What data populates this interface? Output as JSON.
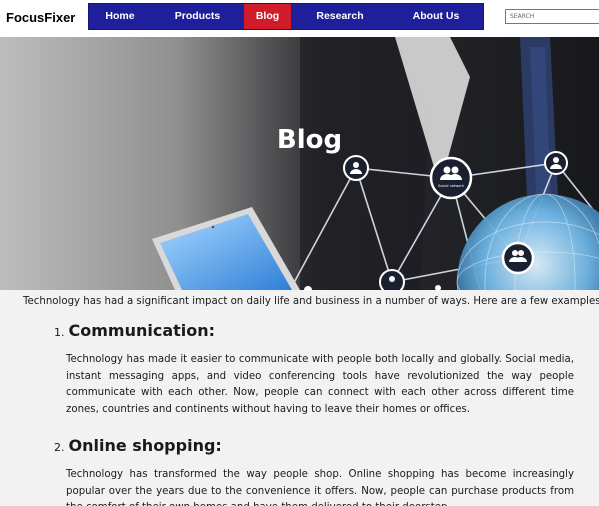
{
  "site": {
    "logo": "FocusFixer"
  },
  "nav": {
    "items": [
      {
        "label": "Home",
        "active": false
      },
      {
        "label": "Products",
        "active": false
      },
      {
        "label": "Blog",
        "active": true
      },
      {
        "label": "Research",
        "active": false
      },
      {
        "label": "About Us",
        "active": false
      }
    ]
  },
  "search": {
    "placeholder": "SEARCH"
  },
  "hero": {
    "title": "Blog",
    "node_label": "Social network"
  },
  "article": {
    "intro": "Technology has had a significant impact on daily life and business in a number of ways. Here are a few examples:",
    "sections": [
      {
        "number": "1.",
        "heading": "Communication:",
        "body": "Technology has made it easier to communicate with people both locally and globally. Social media, instant messaging apps, and video conferencing tools have revolutionized the way people communicate with each other. Now, people can connect with each other across different time zones, countries and continents without having to leave their homes or offices."
      },
      {
        "number": "2.",
        "heading": "Online shopping:",
        "body": "Technology has transformed the way people shop. Online shopping has become increasingly popular over the years due to the convenience it offers. Now, people can purchase products from the comfort of their own homes and have them delivered to their doorstep."
      }
    ]
  },
  "colors": {
    "nav_bg": "#1f1f9c",
    "nav_active": "#d11a2a"
  }
}
